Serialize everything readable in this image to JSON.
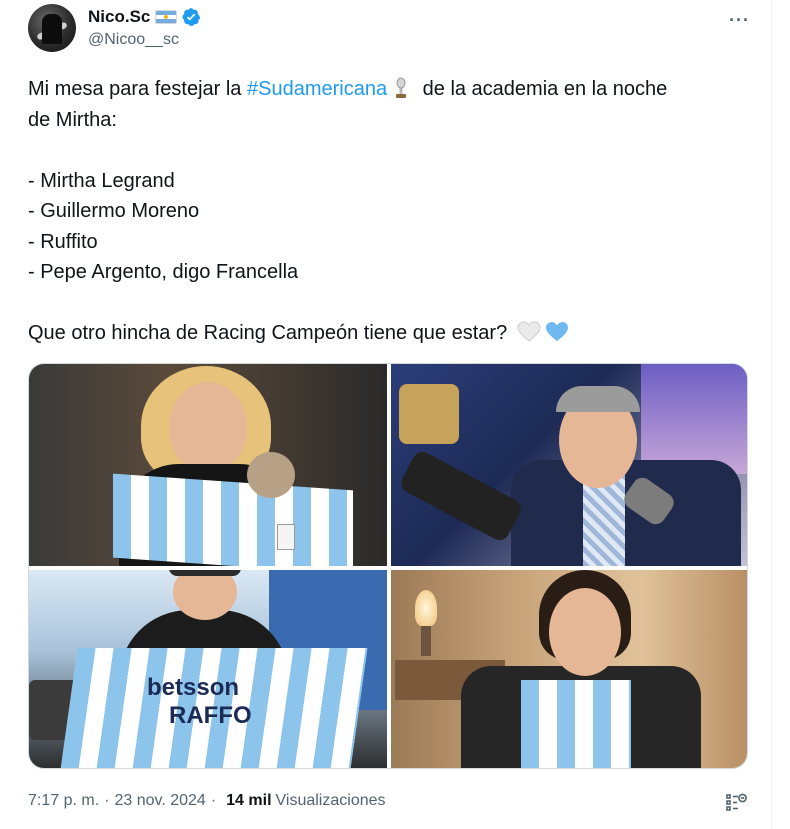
{
  "tweet": {
    "author": {
      "display_name": "Nico.Sc",
      "handle": "@Nicoo__sc",
      "verified": true,
      "flag_icon": "argentina-flag-icon"
    },
    "more_label": "···",
    "text": {
      "line1_prefix": "Mi mesa para festejar la ",
      "hashtag": "#Sudamericana",
      "line1_suffix": " de la academia en la noche\nde Mirtha:\n\n- Mirtha Legrand\n- Guillermo Moreno\n- Ruffito\n- Pepe Argento, digo Francella\n\nQue otro hincha de Racing Campeón tiene que estar?",
      "emojis": [
        "trophy-icon",
        "white-heart-icon",
        "light-blue-heart-icon"
      ]
    },
    "photos": [
      {
        "name": "mirtha-jersey-photo"
      },
      {
        "name": "moreno-microphone-photo"
      },
      {
        "name": "ruffito-jersey-photo",
        "jersey_text_1": "betsson",
        "jersey_text_2": "RAFFO"
      },
      {
        "name": "francella-jersey-photo"
      }
    ],
    "footer": {
      "time": "7:17 p. m.",
      "dot": "·",
      "date": "23 nov. 2024",
      "views_count": "14 mil",
      "views_label": "Visualizaciones"
    },
    "colors": {
      "link": "#1d9bf0",
      "secondary_text": "#536471",
      "primary_text": "#0f1419",
      "verified": "#1d9bf0"
    }
  }
}
